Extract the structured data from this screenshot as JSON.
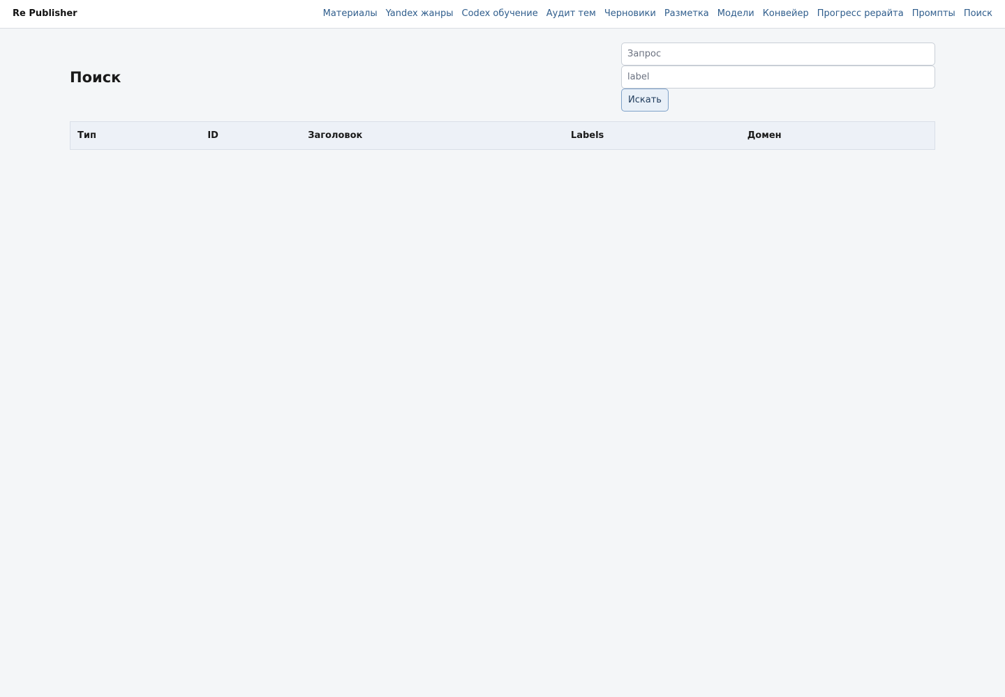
{
  "app": {
    "brand": "Re Publisher"
  },
  "nav": {
    "items": [
      {
        "label": "Материалы"
      },
      {
        "label": "Yandex жанры"
      },
      {
        "label": "Codex обучение"
      },
      {
        "label": "Аудит тем"
      },
      {
        "label": "Черновики"
      },
      {
        "label": "Разметка"
      },
      {
        "label": "Модели"
      },
      {
        "label": "Конвейер"
      },
      {
        "label": "Прогресс рерайта"
      },
      {
        "label": "Промпты"
      },
      {
        "label": "Поиск"
      }
    ]
  },
  "page": {
    "title": "Поиск"
  },
  "search": {
    "query_placeholder": "Запрос",
    "query_value": "",
    "label_placeholder": "label",
    "label_value": "",
    "button_label": "Искать"
  },
  "table": {
    "columns": [
      {
        "label": "Тип"
      },
      {
        "label": "ID"
      },
      {
        "label": "Заголовок"
      },
      {
        "label": "Labels"
      },
      {
        "label": "Домен"
      }
    ],
    "rows": []
  },
  "colors": {
    "background": "#f4f6f8",
    "link": "#2f5d8c",
    "header_row": "#edf1f7",
    "button_bg": "#e9f0f8",
    "button_border": "#7ea1c9"
  }
}
